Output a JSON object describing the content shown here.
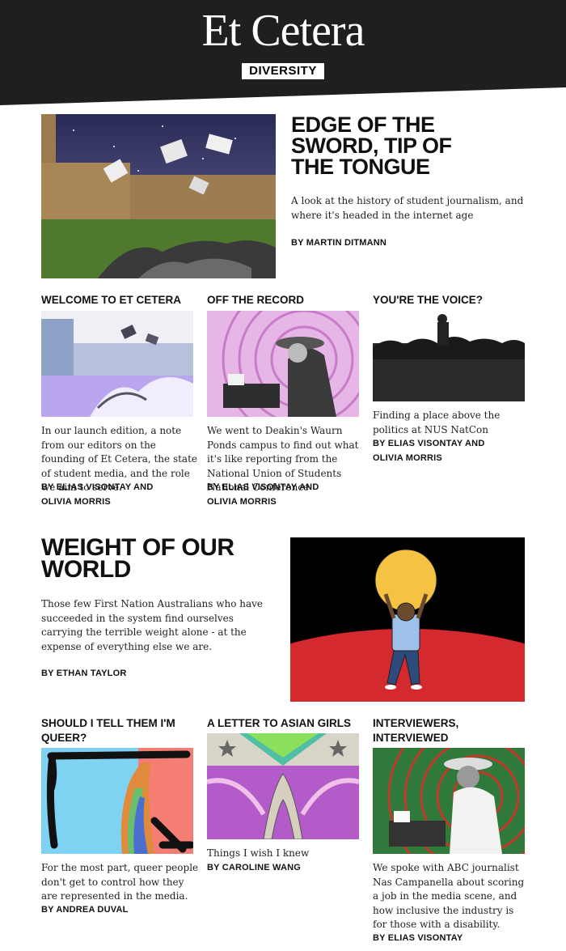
{
  "site": {
    "title": "Et Cetera",
    "section": "DIVERSITY"
  },
  "lead": {
    "title": "EDGE OF THE SWORD, TIP OF THE TONGUE",
    "title_lines": [
      "EDGE OF THE",
      "SWORD, TIP OF",
      "THE TONGUE"
    ],
    "description": "A look at the history of student journalism, and where it's headed in the internet age",
    "byline": "BY MARTIN DITMANN"
  },
  "row1": [
    {
      "title": "WELCOME TO ET CETERA",
      "description": "In our launch edition, a note from our editors on the founding of Et Cetera, the state of student media, and the role we aim to serve.",
      "byline_lines": [
        "BY ELIAS VISONTAY AND",
        "OLIVIA MORRIS"
      ]
    },
    {
      "title": "OFF THE RECORD",
      "description": "We went to Deakin's Waurn Ponds campus to find out what it's like reporting from the National Union of Students National Conference",
      "byline_lines": [
        "BY ELIAS VISONTAY AND",
        "OLIVIA MORRIS"
      ]
    },
    {
      "title": "YOU'RE THE VOICE?",
      "description": "Finding a place above the politics at NUS NatCon",
      "byline_lines": [
        "BY ELIAS VISONTAY AND",
        "OLIVIA MORRIS"
      ]
    }
  ],
  "feature": {
    "title_lines": [
      "WEIGHT OF OUR",
      "WORLD"
    ],
    "description": "Those few First Nation Australians who have succeeded in the system find ourselves carrying the terrible weight alone - at the expense of everything else we are.",
    "byline": "BY ETHAN TAYLOR"
  },
  "row2": [
    {
      "title_lines": [
        "SHOULD I TELL THEM I'M",
        "QUEER?"
      ],
      "description": "For the most part, queer people don't get to control how they are represented in the media.",
      "byline": "BY ANDREA DUVAL"
    },
    {
      "title_lines": [
        "A LETTER TO ASIAN GIRLS"
      ],
      "description": "Things I wish I knew",
      "byline": "BY CAROLINE WANG"
    },
    {
      "title_lines": [
        "INTERVIEWERS,",
        "INTERVIEWED"
      ],
      "description": "We spoke with ABC journalist Nas Campanella about scoring a job in the media scene, and how inclusive the industry is for those with a disability.",
      "byline": "BY ELIAS VISONTAY"
    }
  ],
  "colors": {
    "header_bg": "#1f1f1f",
    "text": "#111111",
    "feature_red": "#d42a2f",
    "feature_sun": "#f6c244"
  }
}
